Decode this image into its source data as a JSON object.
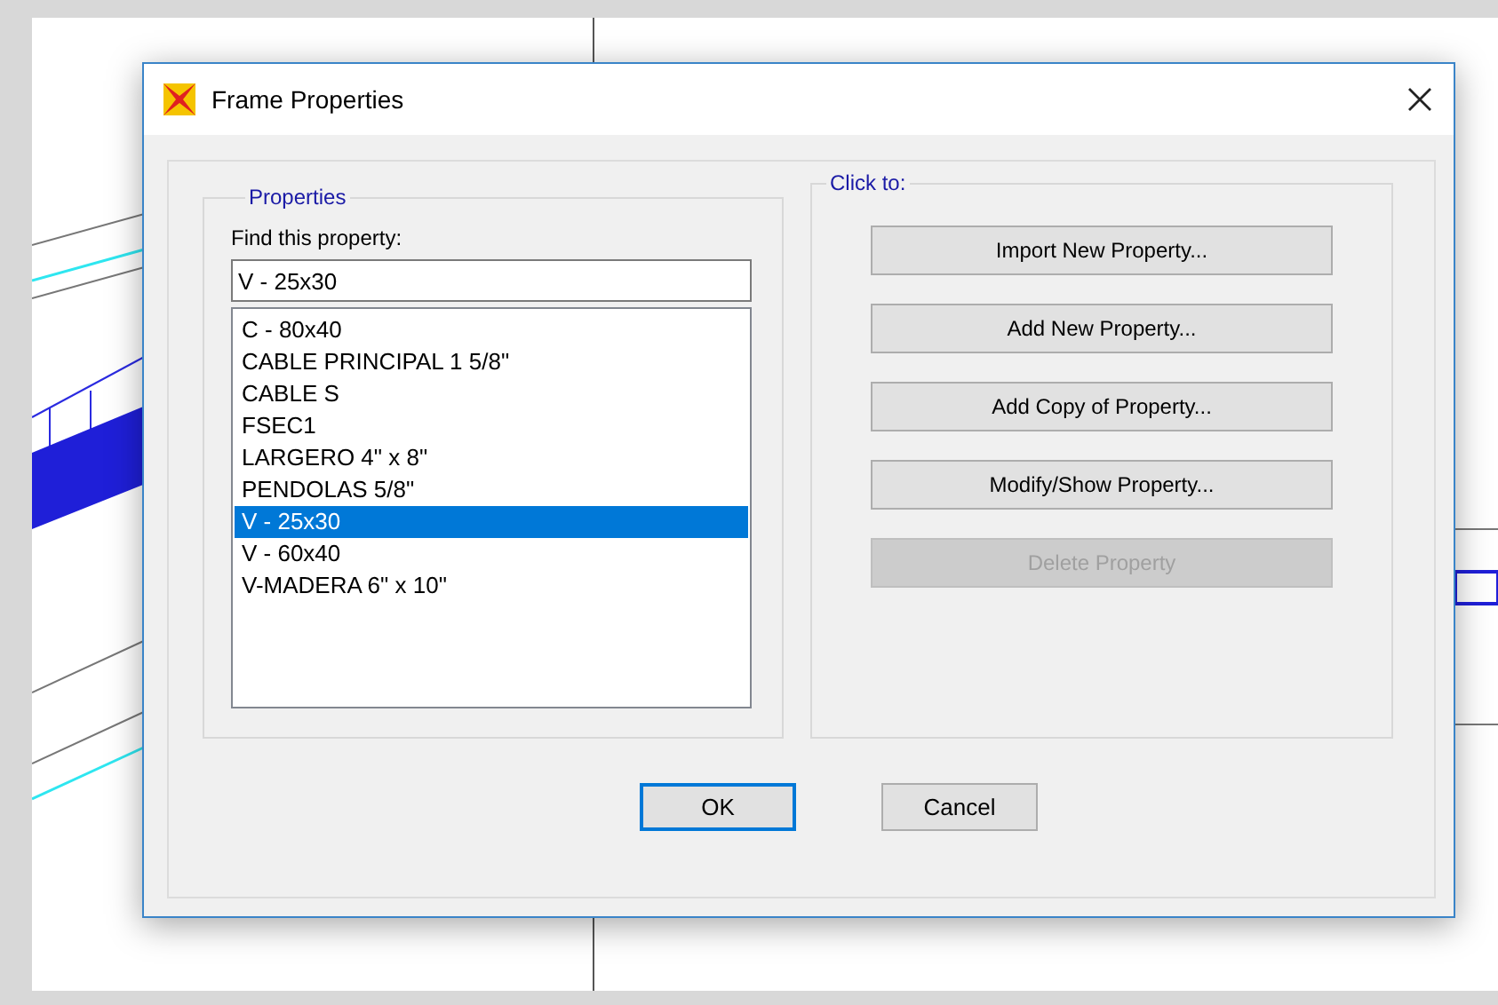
{
  "window": {
    "title": "Frame Properties"
  },
  "properties_group": {
    "title": "Properties",
    "find_label": "Find this property:",
    "search": {
      "value": "V - 25x30"
    },
    "items": [
      {
        "label": "C - 80x40",
        "selected": false
      },
      {
        "label": "CABLE PRINCIPAL 1 5/8\"",
        "selected": false
      },
      {
        "label": "CABLE S",
        "selected": false
      },
      {
        "label": "FSEC1",
        "selected": false
      },
      {
        "label": "LARGERO 4\" x 8\"",
        "selected": false
      },
      {
        "label": "PENDOLAS 5/8\"",
        "selected": false
      },
      {
        "label": "V - 25x30",
        "selected": true
      },
      {
        "label": "V - 60x40",
        "selected": false
      },
      {
        "label": "V-MADERA 6\" x 10\"",
        "selected": false
      }
    ]
  },
  "actions_group": {
    "title": "Click to:",
    "buttons": [
      {
        "label": "Import New Property...",
        "disabled": false
      },
      {
        "label": "Add New Property...",
        "disabled": false
      },
      {
        "label": "Add Copy of Property...",
        "disabled": false
      },
      {
        "label": "Modify/Show Property...",
        "disabled": false
      },
      {
        "label": "Delete Property",
        "disabled": true
      }
    ]
  },
  "dialog_buttons": [
    {
      "label": "OK",
      "focused": true
    },
    {
      "label": "Cancel",
      "focused": false
    }
  ]
}
